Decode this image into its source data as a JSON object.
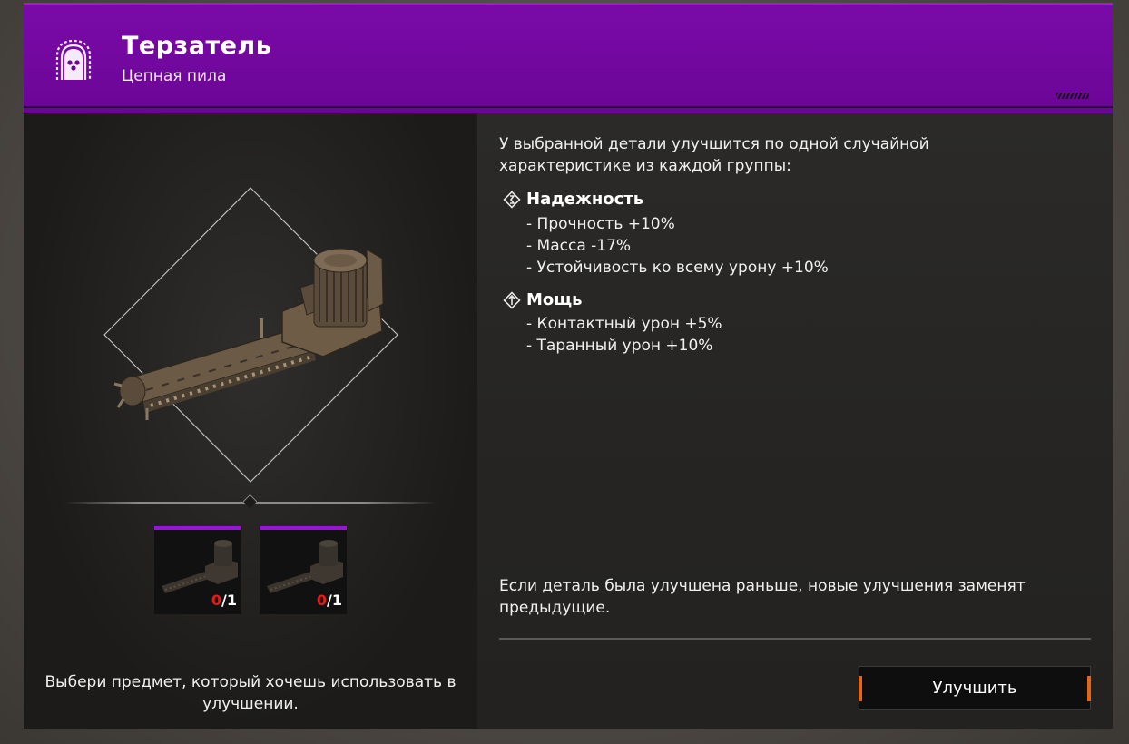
{
  "header": {
    "title": "Терзатель",
    "subtitle": "Цепная пила",
    "icon": "clan-crest-icon",
    "accent_color": "#7a0aa8"
  },
  "description": "У выбранной детали улучшится по одной случайной характеристике из каждой группы:",
  "groups": [
    {
      "icon": "reliability-icon",
      "title": "Надежность",
      "stats": [
        "- Прочность +10%",
        "- Масса -17%",
        "- Устойчивость ко всему урону +10%"
      ]
    },
    {
      "icon": "power-icon",
      "title": "Мощь",
      "stats": [
        "- Контактный урон +5%",
        "- Таранный урон +10%"
      ]
    }
  ],
  "note": "Если деталь была улучшена раньше, новые улучшения заменят предыдущие.",
  "upgrade_button": "Улучшить",
  "slots": [
    {
      "have": "0",
      "sep": "/",
      "need": "1"
    },
    {
      "have": "0",
      "sep": "/",
      "need": "1"
    }
  ],
  "hint": "Выбери предмет, который хочешь использовать в улучшении."
}
